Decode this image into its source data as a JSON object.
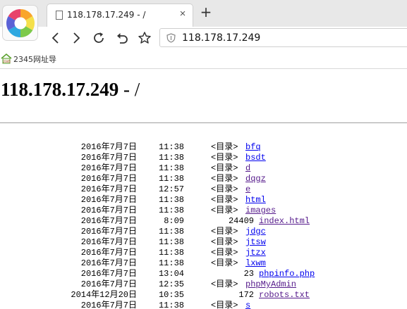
{
  "browser": {
    "tab_title": "118.178.17.249 - /",
    "tab_close": "×",
    "new_tab": "+",
    "address_url": "118.178.17.249",
    "bookmark_label": "2345网址导",
    "bookmark_icon_text": "2345"
  },
  "page": {
    "host": "118.178.17.249",
    "path_suffix": " - /",
    "entries": [
      {
        "date": "2016年7月7日",
        "time": "11:38",
        "dir_label": "<目录>",
        "size": "",
        "name": "bfq",
        "visited": false
      },
      {
        "date": "2016年7月7日",
        "time": "11:38",
        "dir_label": "<目录>",
        "size": "",
        "name": "bsdt",
        "visited": false
      },
      {
        "date": "2016年7月7日",
        "time": "11:38",
        "dir_label": "<目录>",
        "size": "",
        "name": "d",
        "visited": true
      },
      {
        "date": "2016年7月7日",
        "time": "11:38",
        "dir_label": "<目录>",
        "size": "",
        "name": "dqgz",
        "visited": true
      },
      {
        "date": "2016年7月7日",
        "time": "12:57",
        "dir_label": "<目录>",
        "size": "",
        "name": "e",
        "visited": true
      },
      {
        "date": "2016年7月7日",
        "time": "11:38",
        "dir_label": "<目录>",
        "size": "",
        "name": "html",
        "visited": false
      },
      {
        "date": "2016年7月7日",
        "time": "11:38",
        "dir_label": "<目录>",
        "size": "",
        "name": "images",
        "visited": true
      },
      {
        "date": "2016年7月7日",
        "time": "8:09",
        "dir_label": "",
        "size": "24409",
        "name": "index.html",
        "visited": true
      },
      {
        "date": "2016年7月7日",
        "time": "11:38",
        "dir_label": "<目录>",
        "size": "",
        "name": "jdgc",
        "visited": false
      },
      {
        "date": "2016年7月7日",
        "time": "11:38",
        "dir_label": "<目录>",
        "size": "",
        "name": "jtsw",
        "visited": false
      },
      {
        "date": "2016年7月7日",
        "time": "11:38",
        "dir_label": "<目录>",
        "size": "",
        "name": "jtzx",
        "visited": false
      },
      {
        "date": "2016年7月7日",
        "time": "11:38",
        "dir_label": "<目录>",
        "size": "",
        "name": "lxwm",
        "visited": false
      },
      {
        "date": "2016年7月7日",
        "time": "13:04",
        "dir_label": "",
        "size": "23",
        "name": "phpinfo.php",
        "visited": false
      },
      {
        "date": "2016年7月7日",
        "time": "12:35",
        "dir_label": "<目录>",
        "size": "",
        "name": "phpMyAdmin",
        "visited": true
      },
      {
        "date": "2014年12月20日",
        "time": "10:35",
        "dir_label": "",
        "size": "172",
        "name": "robots.txt",
        "visited": true
      },
      {
        "date": "2016年7月7日",
        "time": "11:38",
        "dir_label": "<目录>",
        "size": "",
        "name": "s",
        "visited": false
      }
    ]
  },
  "colors": {
    "link": "#0000ee",
    "visited_link": "#551a8b"
  }
}
